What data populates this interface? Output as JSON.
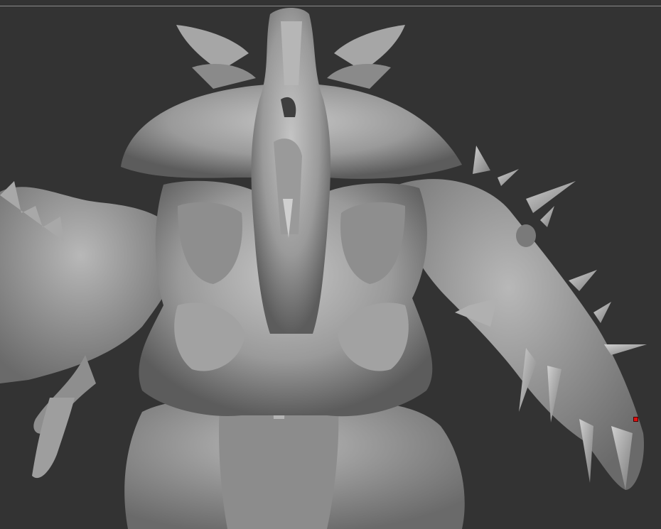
{
  "app": {
    "viewport_label": "",
    "background_color": "#333333"
  },
  "model": {
    "shade_color": "#9c9c9c",
    "highlight_color": "#c8c8c8",
    "shadow_color": "#3e3e3e"
  },
  "marker": {
    "color": "#e01010",
    "icon": "selection-point-icon"
  }
}
